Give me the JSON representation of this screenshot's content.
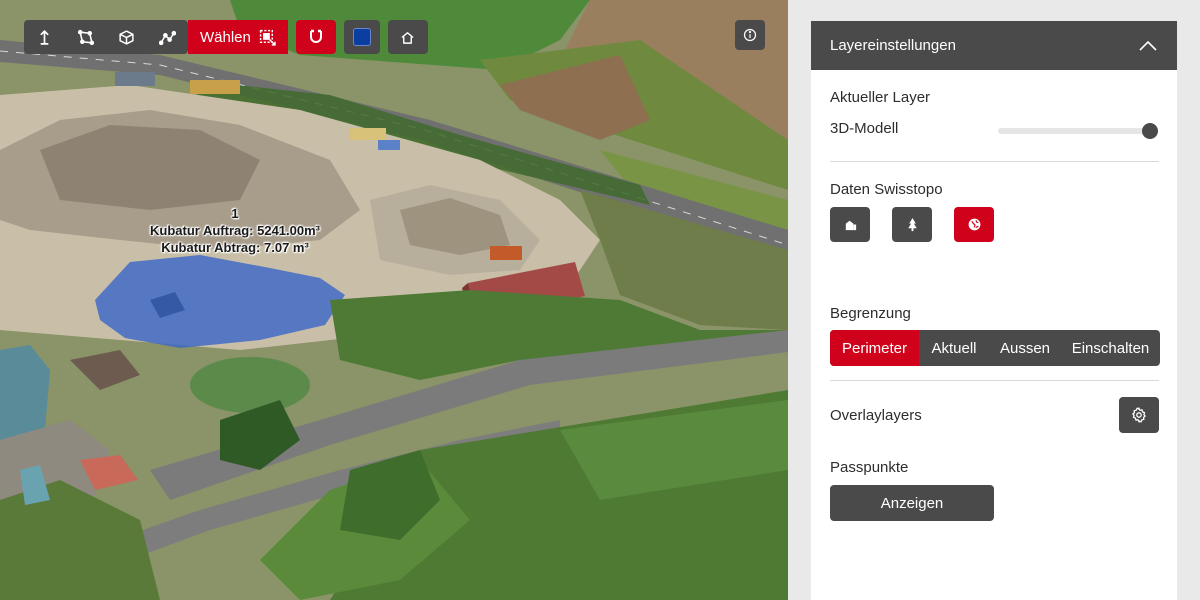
{
  "colors": {
    "accent_red": "#d0021b",
    "button_dark": "#4a4a4a",
    "panel_bg": "#ffffff",
    "selected_color": "#0a3ea0"
  },
  "toolbar": {
    "tools": [
      {
        "name": "vertical-measure-icon"
      },
      {
        "name": "polygon-area-icon"
      },
      {
        "name": "volume-cube-icon"
      },
      {
        "name": "polyline-path-icon"
      }
    ],
    "select_label": "Wählen",
    "select_icon": "select-region-icon",
    "snap_icon": "magnet-icon",
    "color_icon": "color-swatch",
    "home_icon": "home-icon",
    "info_icon": "info-icon"
  },
  "map": {
    "measurement": {
      "id": "1",
      "fill_label": "Kubatur Auftrag: 5241.00m³",
      "cut_label": "Kubatur Abtrag: 7.07 m³"
    }
  },
  "panel": {
    "title": "Layereinstellungen",
    "collapse_icon": "chevron-up-icon",
    "current_layer": {
      "title": "Aktueller Layer",
      "layer_name": "3D-Modell",
      "opacity": 1.0
    },
    "swisstopo": {
      "title": "Daten Swisstopo",
      "buttons": [
        {
          "icon": "buildings-icon",
          "active": false
        },
        {
          "icon": "tree-icon",
          "active": false
        },
        {
          "icon": "globe-icon",
          "active": true
        }
      ]
    },
    "boundary": {
      "title": "Begrenzung",
      "options": [
        "Perimeter",
        "Aktuell",
        "Aussen",
        "Einschalten"
      ],
      "selected": "Perimeter"
    },
    "overlay": {
      "title": "Overlaylayers",
      "icon": "gear-icon"
    },
    "control_points": {
      "title": "Passpunkte",
      "button_label": "Anzeigen"
    }
  }
}
